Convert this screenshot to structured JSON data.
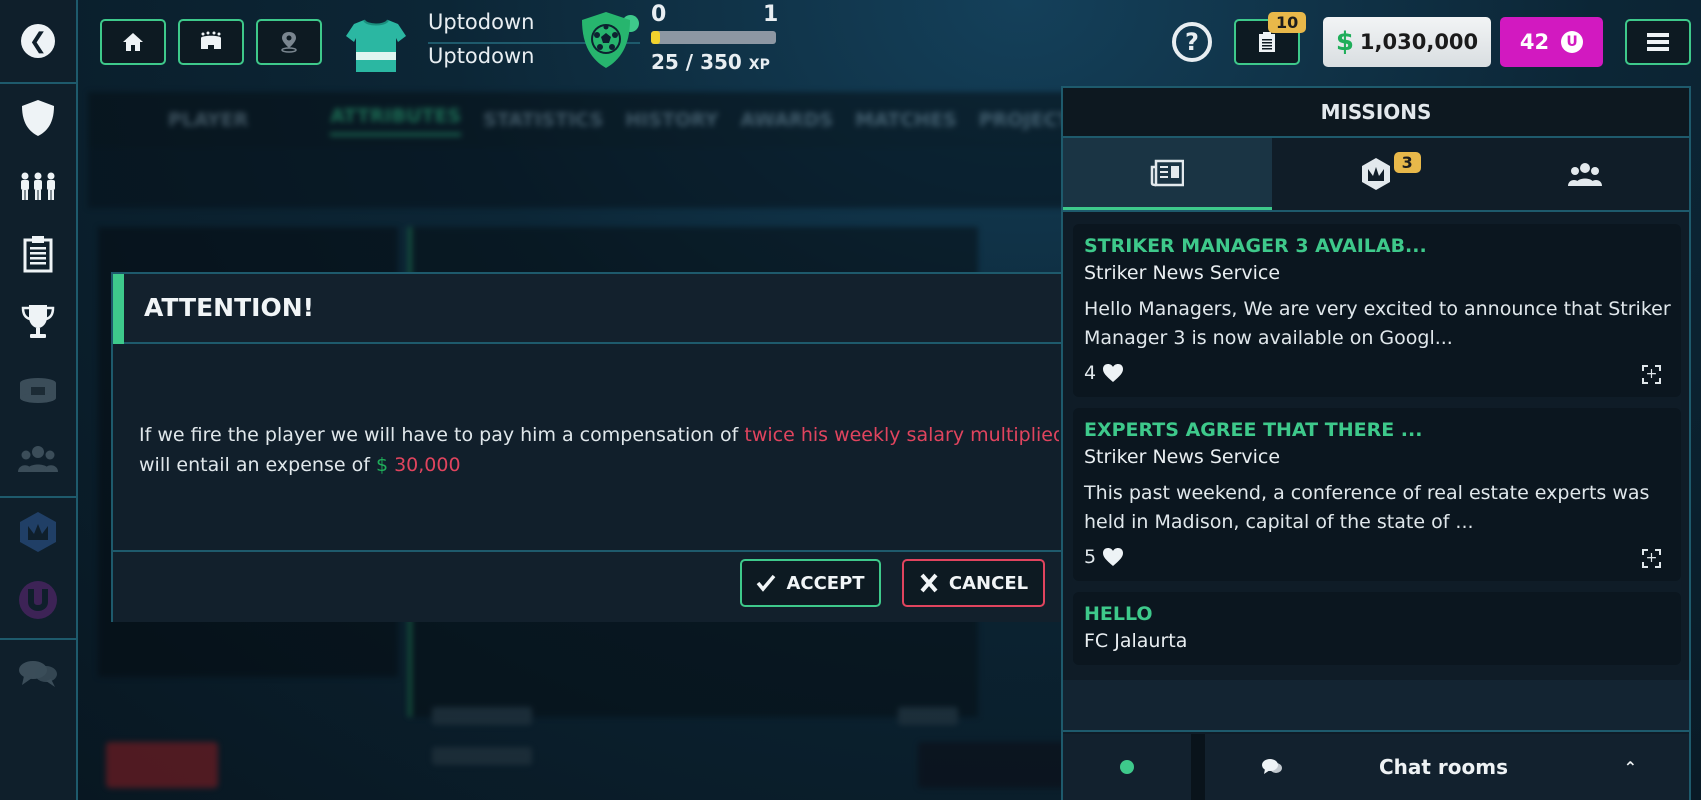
{
  "sidebar": {
    "back_icon": "chevron-left-icon",
    "items": [
      {
        "name": "club",
        "icon": "shield-icon",
        "dim": false
      },
      {
        "name": "squad",
        "icon": "players-icon",
        "dim": false
      },
      {
        "name": "tactics",
        "icon": "clipboard-icon",
        "dim": false
      },
      {
        "name": "competitions",
        "icon": "trophy-icon",
        "dim": false
      },
      {
        "name": "stadium",
        "icon": "stadium-icon",
        "dim": true
      },
      {
        "name": "community",
        "icon": "group-icon",
        "dim": true
      },
      {
        "name": "missions",
        "icon": "crown-hex-icon",
        "dim": true
      },
      {
        "name": "store",
        "icon": "u-coin-icon",
        "dim": true
      },
      {
        "name": "chat",
        "icon": "chat-bubbles-icon",
        "dim": true
      }
    ]
  },
  "topbar": {
    "nav_buttons": [
      {
        "name": "home",
        "icon": "home-icon"
      },
      {
        "name": "stadium",
        "icon": "stadium-icon"
      },
      {
        "name": "location",
        "icon": "map-pin-icon"
      }
    ],
    "team_name": "Uptodown",
    "manager_name": "Uptodown",
    "online_status": "online",
    "level_current": "0",
    "level_next": "1",
    "xp_current": 25,
    "xp_total": 350,
    "xp_text": "25 / 350",
    "xp_unit": "XP",
    "notes_count": "10",
    "money": "1,030,000",
    "money_symbol": "$",
    "coins": "42",
    "coin_symbol": "U"
  },
  "background": {
    "tabs": [
      "PLAYER",
      "ATTRIBUTES",
      "STATISTICS",
      "HISTORY",
      "AWARDS",
      "MATCHES",
      "PROJECTI"
    ],
    "active_tab": "ATTRIBUTES"
  },
  "dialog": {
    "title": "ATTENTION!",
    "message_part1": "If we fire the player we will have to pay him a compensation of ",
    "message_highlight": "twice his weekly salary multiplied",
    "message_part2": "will entail an expense of ",
    "currency_symbol": "$",
    "amount": "30,000",
    "accept_label": "ACCEPT",
    "cancel_label": "CANCEL"
  },
  "missions": {
    "title": "MISSIONS",
    "tabs": [
      {
        "name": "news",
        "icon": "newspaper-icon",
        "active": true
      },
      {
        "name": "missions",
        "icon": "crown-hex-icon",
        "badge": "3"
      },
      {
        "name": "friends",
        "icon": "group-icon"
      }
    ],
    "items": [
      {
        "title": "STRIKER MANAGER 3 AVAILAB...",
        "source": "Striker News Service",
        "body": "Hello Managers, We are very excited to announce that Striker Manager 3 is now available on Googl...",
        "likes": "4"
      },
      {
        "title": "EXPERTS AGREE THAT THERE ...",
        "source": "Striker News Service",
        "body": "This past weekend, a conference of real estate experts was held in Madison, capital of the state of ...",
        "likes": "5"
      },
      {
        "title": "HELLO",
        "source": "FC Jalaurta",
        "body": "",
        "likes": ""
      }
    ],
    "chat_label": "Chat rooms",
    "chat_status": "online"
  }
}
